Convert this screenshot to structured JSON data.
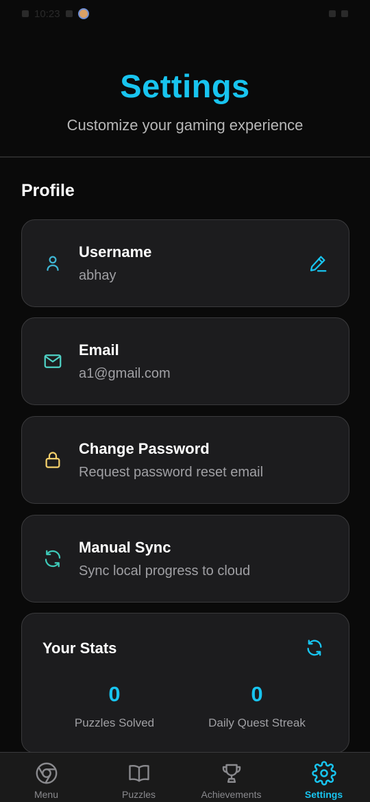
{
  "status_bar": {
    "time": "10:23"
  },
  "header": {
    "title": "Settings",
    "subtitle": "Customize your gaming experience"
  },
  "profile": {
    "section_title": "Profile",
    "username": {
      "label": "Username",
      "value": "abhay"
    },
    "email": {
      "label": "Email",
      "value": "a1@gmail.com"
    },
    "password": {
      "label": "Change Password",
      "value": "Request password reset email"
    },
    "sync": {
      "label": "Manual Sync",
      "value": "Sync local progress to cloud"
    }
  },
  "stats": {
    "title": "Your Stats",
    "items": [
      {
        "value": "0",
        "label": "Puzzles Solved"
      },
      {
        "value": "0",
        "label": "Daily Quest Streak"
      }
    ]
  },
  "nav": {
    "items": [
      {
        "label": "Menu",
        "icon": "chrome-icon"
      },
      {
        "label": "Puzzles",
        "icon": "book-icon"
      },
      {
        "label": "Achievements",
        "icon": "trophy-icon"
      },
      {
        "label": "Settings",
        "icon": "gear-icon"
      }
    ],
    "active_index": 3
  },
  "colors": {
    "accent": "#18c4ef",
    "user_icon": "#3fb6d4",
    "email_icon": "#4fd1c5",
    "lock_icon": "#f5d06b",
    "sync_icon": "#3ec9b8",
    "card_bg": "#1c1c1e",
    "page_bg": "#0a0a0a"
  }
}
